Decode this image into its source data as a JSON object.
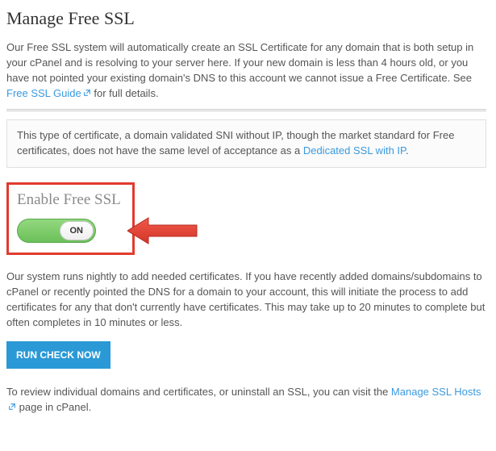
{
  "title": "Manage Free SSL",
  "intro": {
    "text_before": "Our Free SSL system will automatically create an SSL Certificate for any domain that is both setup in your cPanel and is resolving to your server here. If your new domain is less than 4 hours old, or you have not pointed your existing domain's DNS to this account we cannot issue a Free Certificate. See ",
    "link_label": "Free SSL Guide",
    "text_after": " for full details."
  },
  "info_box": {
    "text_before": "This type of certificate, a domain validated SNI without IP, though the market standard for Free certificates, does not have the same level of acceptance as a ",
    "link_label": "Dedicated SSL with IP",
    "text_after": "."
  },
  "enable_section": {
    "heading": "Enable Free SSL",
    "toggle_state": "ON"
  },
  "system_note": "Our system runs nightly to add needed certificates. If you have recently added domains/subdomains to cPanel or recently pointed the DNS for a domain to your account, this will initiate the process to add certificates for any that don't currently have certificates. This may take up to 20 minutes to complete but often completes in 10 minutes or less.",
  "run_button": "RUN CHECK NOW",
  "footer": {
    "text_before": "To review individual domains and certificates, or uninstall an SSL, you can visit the ",
    "link_label": "Manage SSL Hosts",
    "text_after": " page in cPanel."
  },
  "colors": {
    "highlight": "#e23b2e",
    "link": "#3a9adf",
    "button": "#2a99d6"
  }
}
